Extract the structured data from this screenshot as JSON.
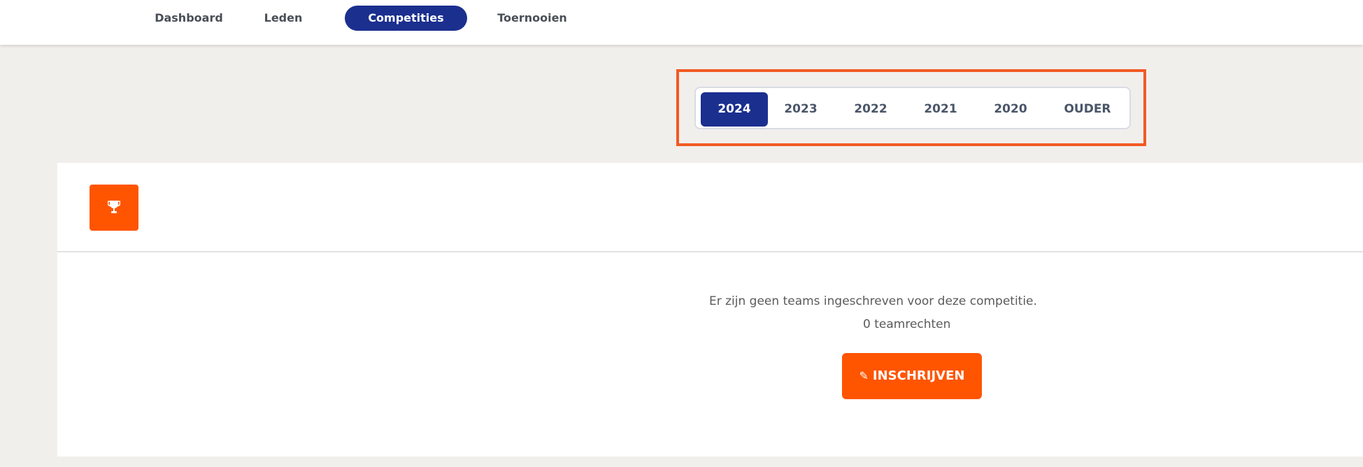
{
  "nav": {
    "items": [
      {
        "label": "Dashboard",
        "active": false
      },
      {
        "label": "Leden",
        "active": false
      },
      {
        "label": "Competities",
        "active": true
      },
      {
        "label": "Toernooien",
        "active": false
      }
    ]
  },
  "years": {
    "items": [
      "2024",
      "2023",
      "2022",
      "2021",
      "2020",
      "OUDER"
    ],
    "selected": "2024"
  },
  "card": {
    "icon": "trophy-icon",
    "empty_message": "Er zijn geen teams ingeschreven voor deze competitie.",
    "team_rights": "0 teamrechten",
    "register_label": "INSCHRIJVEN",
    "register_icon": "pencil-icon"
  },
  "colors": {
    "nav_active": "#1b2f8f",
    "accent": "#ff5500",
    "highlight": "#f15a24"
  }
}
